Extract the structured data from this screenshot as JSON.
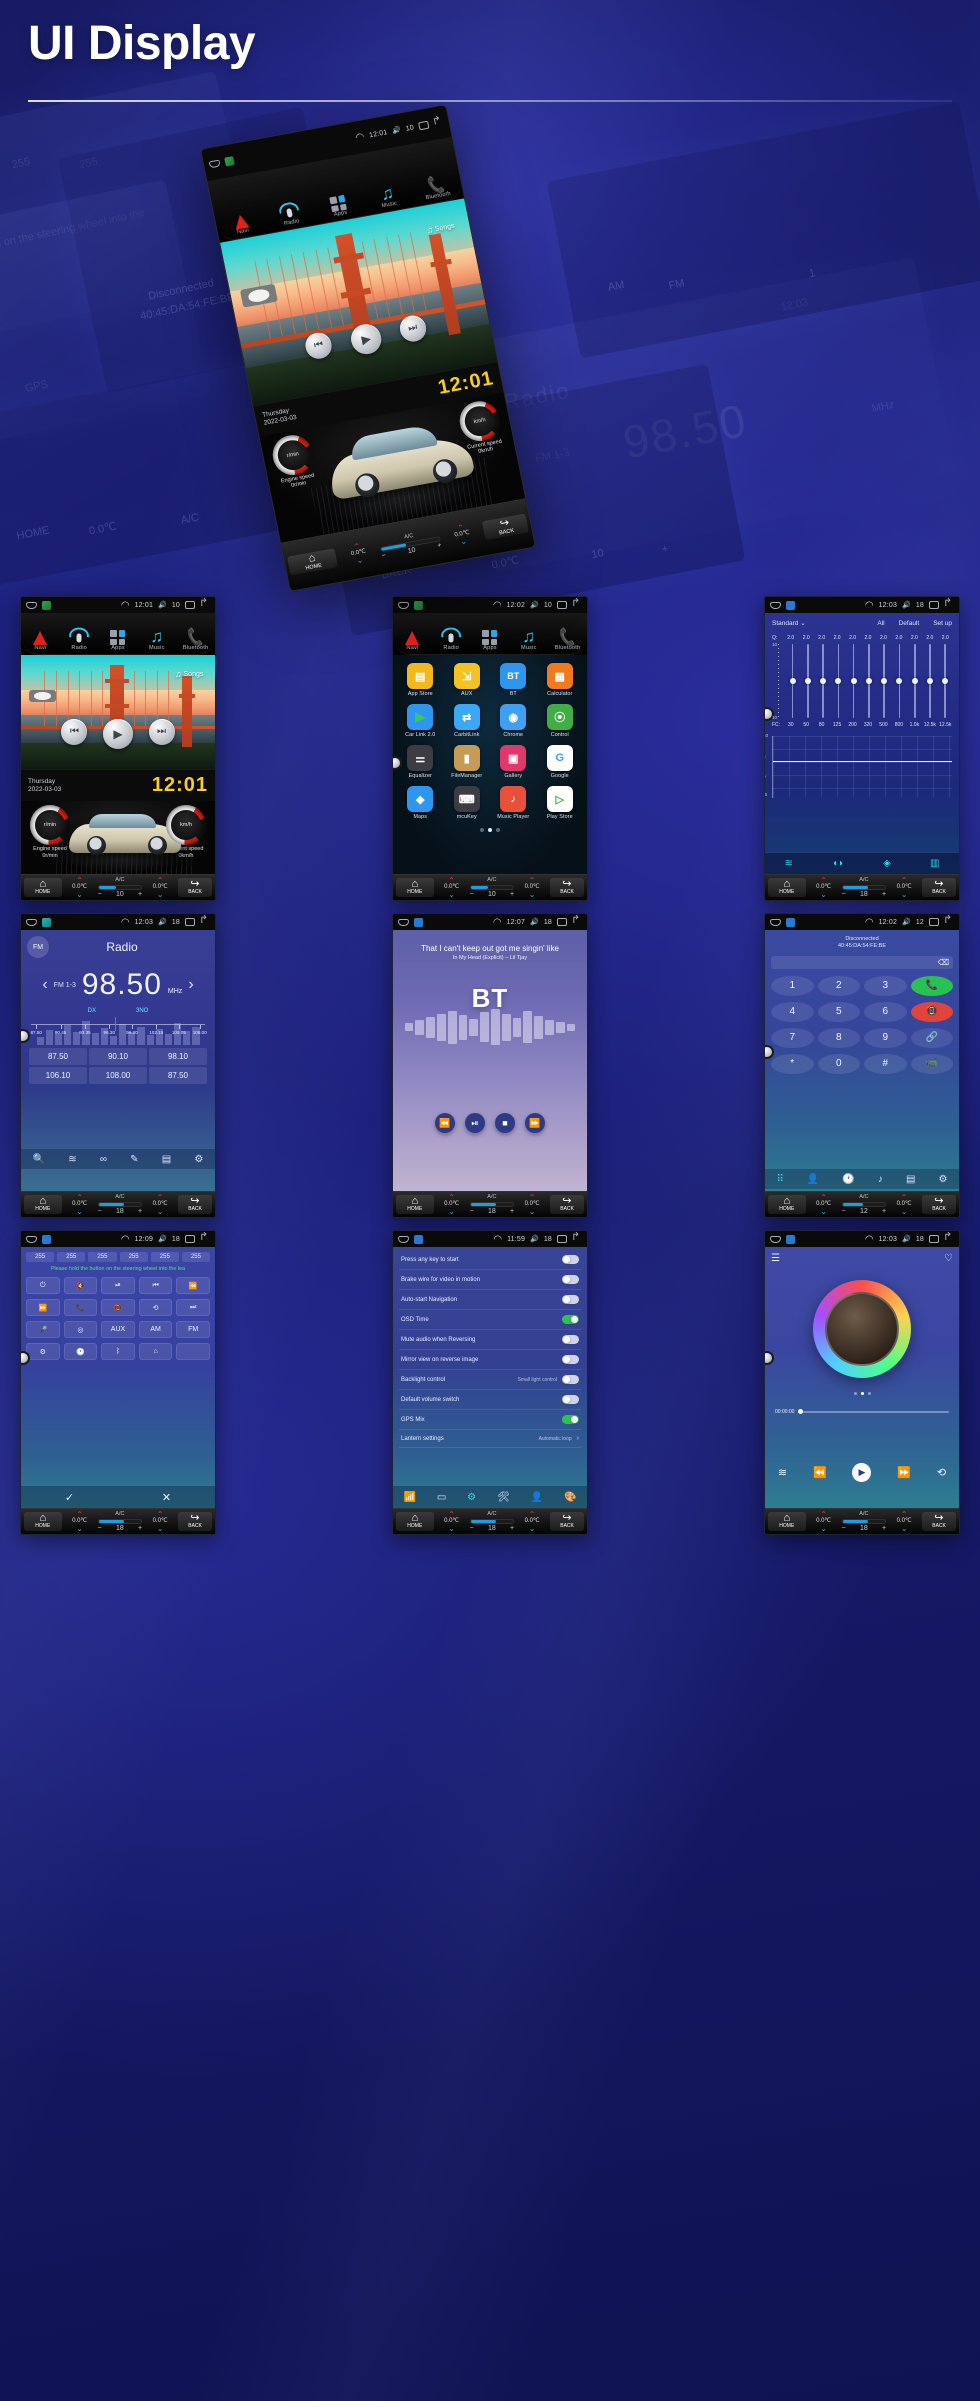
{
  "header": {
    "title": "UI Display"
  },
  "hero": {
    "statusbar": {
      "time": "12:01",
      "volume": "10"
    },
    "nav": [
      {
        "label": "Navi",
        "icon": "navigation-arrow-icon"
      },
      {
        "label": "Radio",
        "icon": "radio-icon"
      },
      {
        "label": "Apps",
        "icon": "apps-grid-icon"
      },
      {
        "label": "Music",
        "icon": "music-note-icon"
      },
      {
        "label": "Bluetooth",
        "icon": "phone-handset-icon"
      }
    ],
    "media": {
      "songs_label": "Songs"
    },
    "date": {
      "weekday": "Thursday",
      "date": "2022-03-03",
      "clock": "12:01"
    },
    "gauges": [
      {
        "title": "Engine speed",
        "value": "0r/min",
        "unit": "r/min"
      },
      {
        "title": "Current speed",
        "value": "0km/h",
        "unit": "km/h"
      }
    ],
    "climate": {
      "home": "HOME",
      "back": "BACK",
      "temp_left": "0.0℃",
      "temp_right": "0.0℃",
      "ac": "A/C",
      "fan": "10",
      "seat": "0"
    }
  },
  "thumbs": [
    {
      "id": "home-media",
      "statusbar": {
        "time": "12:01",
        "volume": "10"
      },
      "nav": [
        "Navi",
        "Radio",
        "Apps",
        "Music",
        "Bluetooth"
      ],
      "songs_label": "Songs",
      "date": {
        "weekday": "Thursday",
        "date": "2022-03-03",
        "clock": "12:01"
      },
      "gauges": [
        {
          "title": "Engine speed",
          "value": "0r/min",
          "unit": "r/min"
        },
        {
          "title": "Current speed",
          "value": "0km/h",
          "unit": "km/h"
        }
      ],
      "climate": {
        "home": "HOME",
        "back": "BACK",
        "temp_left": "0.0℃",
        "temp_right": "0.0℃",
        "ac": "A/C",
        "fan": "10",
        "seat": "0"
      }
    },
    {
      "id": "app-launcher",
      "statusbar": {
        "time": "12:02",
        "volume": "10"
      },
      "nav": [
        "Navi",
        "Radio",
        "Apps",
        "Music",
        "Bluetooth"
      ],
      "apps": [
        {
          "label": "App Store",
          "glyph": "▤",
          "color": "#f5b81c"
        },
        {
          "label": "AUX",
          "glyph": "⇲",
          "color": "#f5c224"
        },
        {
          "label": "BT",
          "glyph": "BT",
          "color": "#2f96f0"
        },
        {
          "label": "Calculator",
          "glyph": "▦",
          "color": "#f07a1e"
        },
        {
          "label": "Car Link 2.0",
          "glyph": "▶",
          "color": "#2f96f0"
        },
        {
          "label": "CarbitLink",
          "glyph": "⇄",
          "color": "#3aa8f5"
        },
        {
          "label": "Chrome",
          "glyph": "◉",
          "color": "#3ea0f0"
        },
        {
          "label": "Control",
          "glyph": "⦿",
          "color": "#3fae45"
        },
        {
          "label": "Equalizer",
          "glyph": "⚌",
          "color": "#3c3c42"
        },
        {
          "label": "FileManager",
          "glyph": "▮",
          "color": "#c79a55"
        },
        {
          "label": "Gallery",
          "glyph": "▣",
          "color": "#e0386b"
        },
        {
          "label": "Google",
          "glyph": "G",
          "color": "#ffffff"
        },
        {
          "label": "Maps",
          "glyph": "◈",
          "color": "#2f96f0"
        },
        {
          "label": "mcuKey",
          "glyph": "⌨",
          "color": "#3c3c42"
        },
        {
          "label": "Music Player",
          "glyph": "♪",
          "color": "#e8503a"
        },
        {
          "label": "Play Store",
          "glyph": "▷",
          "color": "#ffffff"
        }
      ],
      "pages": 3,
      "active_page": 1,
      "climate": {
        "home": "HOME",
        "back": "BACK",
        "temp_left": "0.0℃",
        "temp_right": "0.0℃",
        "ac": "A/C",
        "fan": "10",
        "seat": "0"
      }
    },
    {
      "id": "equalizer",
      "statusbar": {
        "time": "12:03",
        "volume": "18"
      },
      "preset": "Standard",
      "links": [
        "All",
        "Default",
        "Set up"
      ],
      "q_label": "Q:",
      "q_values": [
        "2.0",
        "2.0",
        "2.0",
        "2.0",
        "2.0",
        "2.0",
        "2.0",
        "2.0",
        "2.0",
        "2.0",
        "2.0"
      ],
      "fc_label": "FC:",
      "fc_values": [
        "30",
        "50",
        "80",
        "125",
        "200",
        "320",
        "500",
        "800",
        "1.0k",
        "12.5k",
        "12.5k"
      ],
      "axis_top": "10",
      "axis_bottom": "10",
      "chart_y": [
        "10",
        "5",
        "0",
        "-5",
        "-10"
      ],
      "footer_icons": [
        "equalizer-bars-icon",
        "car-audio-icon",
        "balance-icon",
        "spectrum-icon"
      ],
      "climate": {
        "home": "HOME",
        "back": "BACK",
        "temp_left": "0.0℃",
        "temp_right": "0.0℃",
        "ac": "A/C",
        "fan": "18",
        "seat": "0"
      }
    },
    {
      "id": "radio",
      "statusbar": {
        "time": "12:03",
        "volume": "18"
      },
      "band": "FM",
      "title": "Radio",
      "preset_band": "FM 1-3",
      "frequency": "98.50",
      "unit": "MHz",
      "dx": "DX",
      "st": "3NO",
      "scale_labels": [
        "87.50",
        "90.45",
        "93.35",
        "96.30",
        "99.20",
        "102.15",
        "105.05",
        "108.00"
      ],
      "presets": [
        "87.50",
        "90.10",
        "98.10",
        "106.10",
        "108.00",
        "87.50"
      ],
      "tool_icons": [
        "search-icon",
        "band-icon",
        "link-icon",
        "edit-icon",
        "save-icon",
        "settings-icon"
      ],
      "climate": {
        "home": "HOME",
        "back": "BACK",
        "temp_left": "0.0℃",
        "temp_right": "0.0℃",
        "ac": "A/C",
        "fan": "18",
        "seat": "0"
      }
    },
    {
      "id": "bluetooth-music",
      "statusbar": {
        "time": "12:07",
        "volume": "18"
      },
      "track_title": "That I can't keep out got me singin' like",
      "track_sub": "In My Head (Explicit) – Lil Tjay",
      "logo": "BT",
      "controls": [
        "rewind-icon",
        "play-pause-icon",
        "stop-icon",
        "forward-icon"
      ],
      "climate": {
        "home": "HOME",
        "back": "BACK",
        "temp_left": "0.0℃",
        "temp_right": "0.0℃",
        "ac": "A/C",
        "fan": "18",
        "seat": "0"
      }
    },
    {
      "id": "phone-dialer",
      "statusbar": {
        "time": "12:02",
        "volume": "12"
      },
      "status": "Disconnected",
      "mac": "40:45:DA:54:FE:BE",
      "keys": [
        "1",
        "2",
        "3",
        "4",
        "5",
        "6",
        "7",
        "8",
        "9",
        "*",
        "0",
        "#"
      ],
      "side_keys": [
        "call-icon",
        "hangup-icon",
        "link-icon",
        "video-off-icon"
      ],
      "tool_icons": [
        "dialpad-icon",
        "contacts-icon",
        "recents-icon",
        "music-icon",
        "list-icon",
        "settings-icon"
      ],
      "climate": {
        "home": "HOME",
        "back": "BACK",
        "temp_left": "0.0℃",
        "temp_right": "0.0℃",
        "ac": "A/C",
        "fan": "12",
        "seat": "0"
      }
    },
    {
      "id": "steering-wheel-control",
      "statusbar": {
        "time": "12:09",
        "volume": "18"
      },
      "values": [
        "255",
        "255",
        "255",
        "255",
        "255",
        "255"
      ],
      "note": "Please hold the button on the steering wheel into the lea",
      "buttons": [
        "power-icon",
        "mute-icon",
        "play-pause-icon",
        "prev-track-icon",
        "rewind-icon",
        "fast-forward-icon",
        "phone-icon",
        "hangup-icon",
        "seek-icon",
        "next-track-icon",
        "mic-icon",
        "mode-icon",
        "AUX",
        "AM",
        "FM",
        "settings-icon",
        "clock-icon",
        "bluetooth-icon",
        "home-icon",
        ""
      ],
      "confirm": "check-icon",
      "cancel": "close-icon",
      "climate": {
        "home": "HOME",
        "back": "BACK",
        "temp_left": "0.0℃",
        "temp_right": "0.0℃",
        "ac": "A/C",
        "fan": "18",
        "seat": "0"
      }
    },
    {
      "id": "settings",
      "statusbar": {
        "time": "11:59",
        "volume": "18"
      },
      "rows": [
        {
          "label": "Press any key to start",
          "sub": "",
          "state": "off",
          "type": "toggle"
        },
        {
          "label": "Brake wire for video in motion",
          "sub": "",
          "state": "off",
          "type": "toggle"
        },
        {
          "label": "Auto-start Navigation",
          "sub": "",
          "state": "off",
          "type": "toggle"
        },
        {
          "label": "OSD Time",
          "sub": "",
          "state": "on",
          "type": "toggle"
        },
        {
          "label": "Mute audio when Reversing",
          "sub": "",
          "state": "off",
          "type": "toggle"
        },
        {
          "label": "Mirror view on reverse image",
          "sub": "",
          "state": "off",
          "type": "toggle"
        },
        {
          "label": "Backlight control",
          "sub": "Small light control",
          "state": "off",
          "type": "toggle"
        },
        {
          "label": "Default volume switch",
          "sub": "",
          "state": "off",
          "type": "toggle"
        },
        {
          "label": "GPS Mix",
          "sub": "",
          "state": "on",
          "type": "toggle"
        },
        {
          "label": "Lantern settings",
          "sub": "Automatic loop",
          "state": "",
          "type": "chevron"
        }
      ],
      "foot_icons": [
        "wifi-icon",
        "display-icon",
        "settings-gear-icon",
        "tools-icon",
        "user-icon",
        "palette-icon"
      ],
      "climate": {
        "home": "HOME",
        "back": "BACK",
        "temp_left": "0.0℃",
        "temp_right": "0.0℃",
        "ac": "A/C",
        "fan": "18",
        "seat": "0"
      }
    },
    {
      "id": "music-player",
      "statusbar": {
        "time": "12:03",
        "volume": "18"
      },
      "list_icon": "playlist-icon",
      "fav_icon": "heart-icon",
      "elapsed": "00:00:00",
      "controls": [
        "equalizer-icon",
        "prev-track-icon",
        "play-icon",
        "next-track-icon",
        "loop-icon"
      ],
      "climate": {
        "home": "HOME",
        "back": "BACK",
        "temp_left": "0.0℃",
        "temp_right": "0.0℃",
        "ac": "A/C",
        "fan": "18",
        "seat": "0"
      }
    }
  ],
  "ghost_texts": {
    "g1": "255",
    "g2": "255",
    "g3": "255",
    "g4": "Disconnected",
    "g5": "40:45:DA:54:FE:BE",
    "g6": "Radio",
    "g7": "98.50",
    "g8": "FM 1-3",
    "g9": "MHz",
    "g10": "AM",
    "g11": "FM",
    "g12": "BACK",
    "g13": "HOME",
    "g14": "0.0℃",
    "g15": "12:03",
    "g16": "18",
    "g17": "A/C",
    "g18": "GPS",
    "g19": "the button on the steering wheel into the",
    "g20": "1",
    "g21": "0.0℃",
    "g22": "+",
    "g23": "10"
  },
  "colors": {
    "brand_blue": "#1e2280",
    "accent_cyan": "#2fd3e8",
    "accent_red": "#e32118",
    "accent_yellow": "#f5d11f",
    "toggle_on": "#2fc24f"
  }
}
